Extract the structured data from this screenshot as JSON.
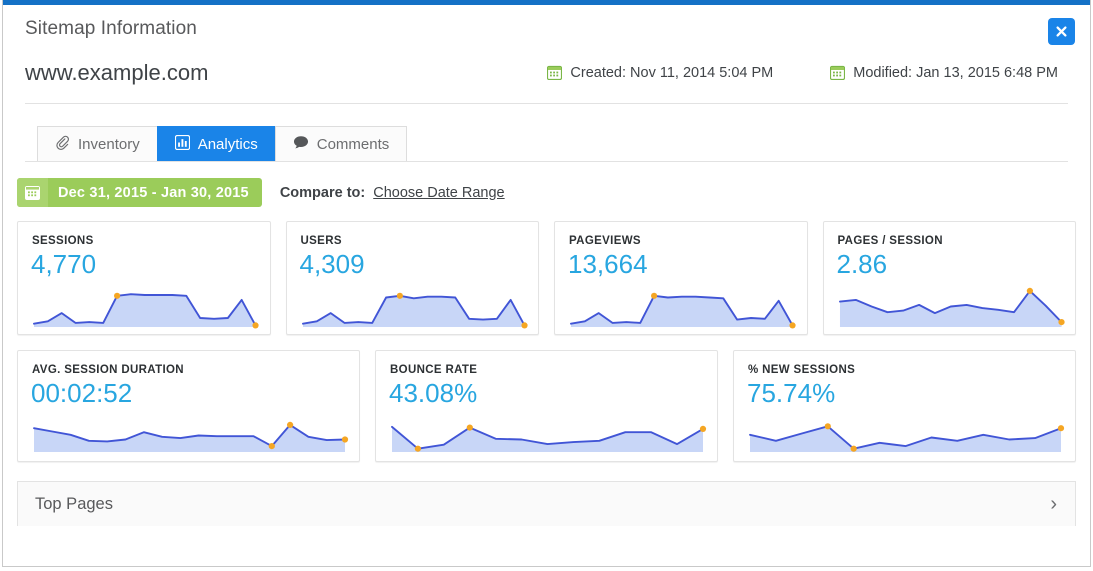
{
  "window": {
    "title": "Sitemap Information",
    "site_url": "www.example.com",
    "close_label": "✕"
  },
  "meta": {
    "created": "Created: Nov 11, 2014 5:04 PM",
    "modified": "Modified: Jan 13, 2015 6:48 PM"
  },
  "tabs": [
    {
      "label": "Inventory",
      "icon": "paperclip-icon",
      "active": false
    },
    {
      "label": "Analytics",
      "icon": "bar-chart-icon",
      "active": true
    },
    {
      "label": "Comments",
      "icon": "comment-bubble-icon",
      "active": false
    }
  ],
  "date_bar": {
    "range": "Dec 31, 2015 - Jan 30, 2015",
    "compare_label": "Compare to:",
    "compare_link": "Choose Date Range",
    "icon": "calendar-icon"
  },
  "colors": {
    "accent_blue": "#1a84e8",
    "value_blue": "#28a6e0",
    "green": "#9bcc5a",
    "green_light": "#aad46f",
    "spark_line": "#4155d6",
    "spark_fill": "#c8d6f7",
    "spark_dot": "#f5a623",
    "top_rule": "#1471c6"
  },
  "footer": {
    "top_pages_label": "Top Pages",
    "chevron": "›"
  },
  "chart_data": [
    {
      "type": "area",
      "title": "SESSIONS",
      "value": "4,770",
      "values": [
        8,
        14,
        34,
        10,
        12,
        10,
        76,
        80,
        78,
        78,
        78,
        76,
        22,
        20,
        22,
        66,
        4
      ],
      "ylim": [
        0,
        100
      ],
      "grid": false,
      "markers": [
        6,
        16
      ]
    },
    {
      "type": "area",
      "title": "USERS",
      "value": "4,309",
      "values": [
        8,
        14,
        34,
        10,
        12,
        10,
        72,
        76,
        70,
        74,
        74,
        72,
        20,
        18,
        20,
        66,
        4
      ],
      "ylim": [
        0,
        100
      ],
      "grid": false,
      "markers": [
        7,
        16
      ]
    },
    {
      "type": "area",
      "title": "PAGEVIEWS",
      "value": "13,664",
      "values": [
        8,
        14,
        34,
        10,
        12,
        10,
        76,
        72,
        74,
        74,
        72,
        70,
        18,
        22,
        20,
        64,
        4
      ],
      "ylim": [
        0,
        100
      ],
      "grid": false,
      "markers": [
        6,
        16
      ]
    },
    {
      "type": "area",
      "title": "PAGES / SESSION",
      "value": "2.86",
      "values": [
        62,
        66,
        50,
        36,
        40,
        54,
        34,
        50,
        54,
        46,
        42,
        36,
        88,
        52,
        12
      ],
      "ylim": [
        0,
        100
      ],
      "grid": false,
      "markers": [
        12,
        14
      ]
    },
    {
      "type": "area",
      "title": "AVG. SESSION DURATION",
      "value": "00:02:52",
      "values": [
        72,
        62,
        52,
        34,
        32,
        38,
        60,
        46,
        42,
        50,
        48,
        48,
        48,
        18,
        82,
        46,
        36,
        38
      ],
      "ylim": [
        0,
        100
      ],
      "grid": false,
      "markers": [
        13,
        14,
        17
      ]
    },
    {
      "type": "area",
      "title": "BOUNCE RATE",
      "value": "43.08%",
      "values": [
        76,
        10,
        22,
        74,
        40,
        38,
        24,
        30,
        34,
        60,
        60,
        24,
        70
      ],
      "ylim": [
        0,
        100
      ],
      "grid": false,
      "markers": [
        1,
        3,
        12
      ]
    },
    {
      "type": "area",
      "title": "% NEW SESSIONS",
      "value": "75.74%",
      "values": [
        52,
        34,
        56,
        78,
        10,
        28,
        18,
        44,
        34,
        52,
        38,
        42,
        72
      ],
      "ylim": [
        0,
        100
      ],
      "grid": false,
      "markers": [
        3,
        4,
        12
      ]
    }
  ]
}
